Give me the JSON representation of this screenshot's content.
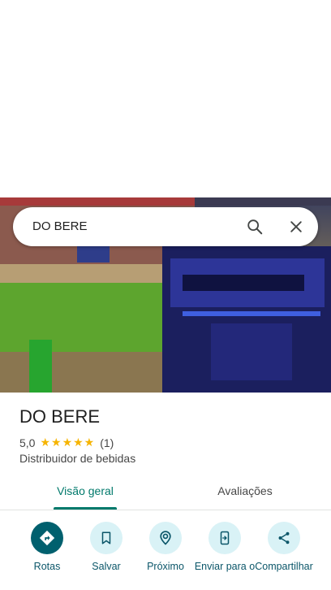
{
  "search": {
    "query": "DO BERE"
  },
  "place": {
    "name": "DO BERE",
    "rating": "5,0",
    "stars": "★★★★★",
    "review_count": "(1)",
    "category": "Distribuidor de bebidas"
  },
  "tabs": [
    {
      "label": "Visão geral",
      "active": true
    },
    {
      "label": "Avaliações",
      "active": false
    }
  ],
  "actions": [
    {
      "label": "Rotas",
      "icon": "directions-icon"
    },
    {
      "label": "Salvar",
      "icon": "bookmark-icon"
    },
    {
      "label": "Próximo",
      "icon": "nearby-icon"
    },
    {
      "label": "Enviar para o",
      "icon": "send-to-phone-icon"
    },
    {
      "label": "Compartilhar",
      "icon": "share-icon"
    }
  ],
  "colors": {
    "accent": "#00796b",
    "primary_action": "#00606e",
    "action_bg": "#d9f2f6",
    "star": "#f6b400"
  }
}
